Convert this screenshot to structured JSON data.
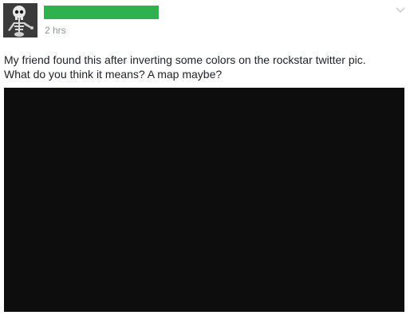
{
  "post": {
    "timestamp": "2 hrs",
    "text_line_1": "My friend found this after inverting some colors on the rockstar twitter pic.",
    "text_line_2": "What do you think it means? A map maybe?",
    "author_redaction_color": "#2db24e",
    "image_color": "#0d0d0d"
  },
  "icons": {
    "avatar": "skeleton-avatar",
    "options": "chevron-down-icon"
  }
}
